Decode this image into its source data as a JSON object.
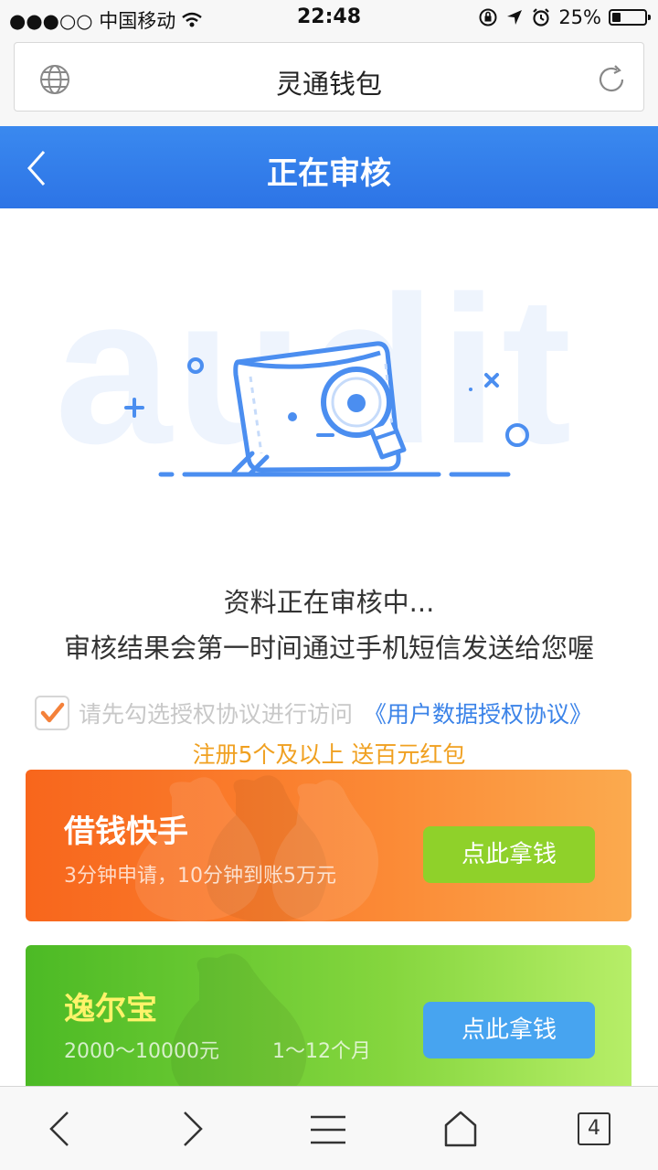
{
  "status_bar": {
    "carrier": "●●●○○ 中国移动",
    "time": "22:48",
    "battery": "25%",
    "battery_level": 0.25
  },
  "browser": {
    "title": "灵通钱包",
    "globe_icon": "globe-icon",
    "reload_icon": "reload-icon"
  },
  "header": {
    "title": "正在审核",
    "back_icon": "chevron-left-icon",
    "color": "#2d74e6"
  },
  "illustration": {
    "bg_text": "audit"
  },
  "message": {
    "line1": "资料正在审核中...",
    "line2": "审核结果会第一时间通过手机短信发送给您喔"
  },
  "agreement": {
    "checked": true,
    "text": "请先勾选授权协议进行访问",
    "link": "《用户数据授权协议》"
  },
  "promo": "注册5个及以上 送百元红包",
  "cards": [
    {
      "name": "借钱快手",
      "desc": "3分钟申请，10分钟到账5万元",
      "button": "点此拿钱"
    },
    {
      "name": "逸尔宝",
      "desc": "2000～10000元",
      "desc2": "1～12个月",
      "button": "点此拿钱"
    }
  ],
  "toolbar": {
    "tab_count": "4"
  }
}
